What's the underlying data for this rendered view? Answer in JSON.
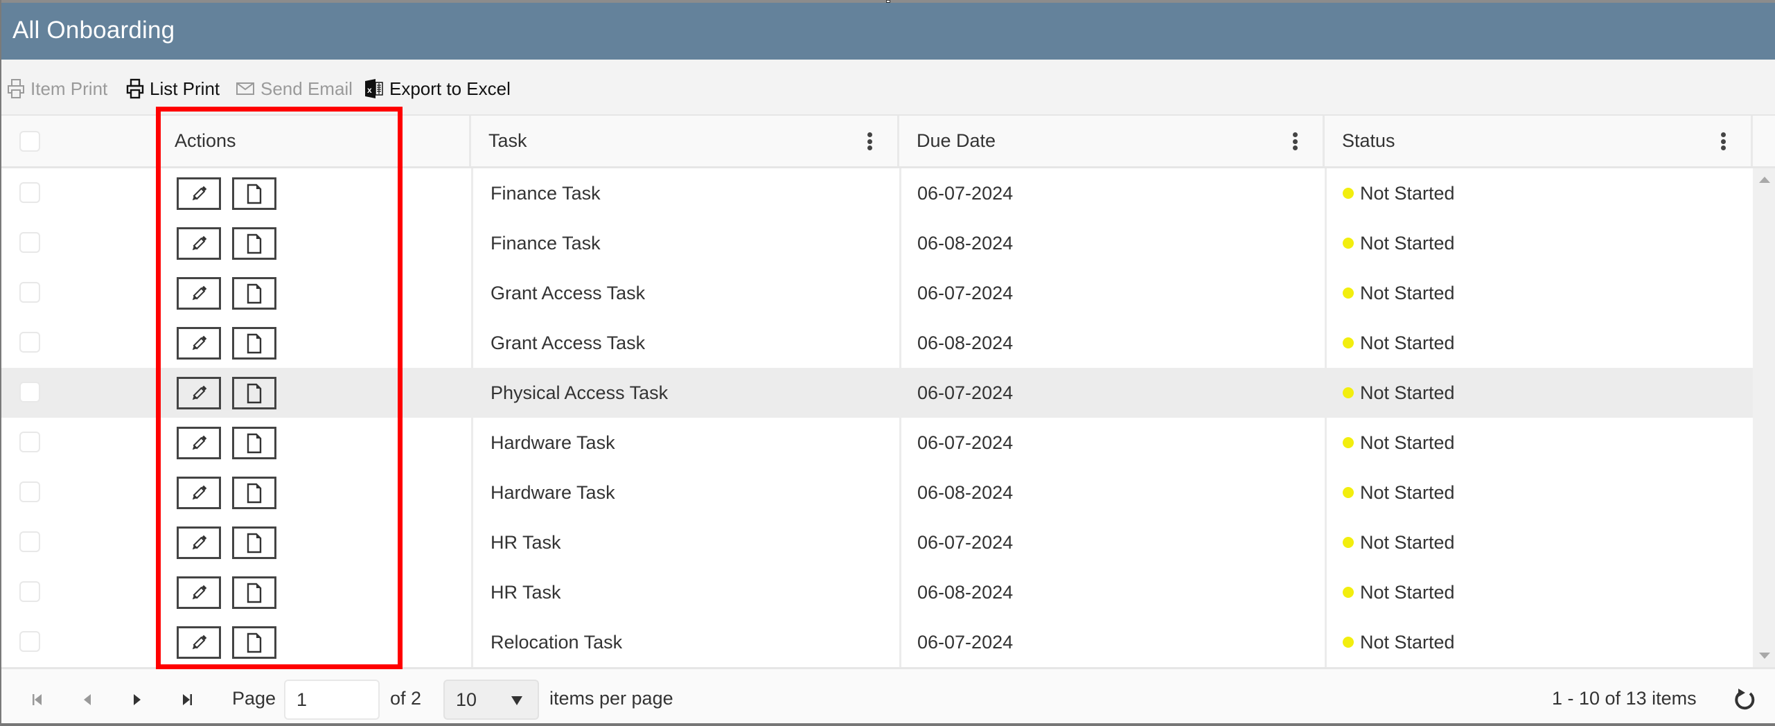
{
  "window": {
    "title": "All Onboarding",
    "title_bar_color": "#64829b"
  },
  "toolbar": {
    "items": [
      {
        "label": "Item Print",
        "icon": "printer-icon",
        "enabled": false
      },
      {
        "label": "List Print",
        "icon": "printer-icon",
        "enabled": true
      },
      {
        "label": "Send Email",
        "icon": "envelope-icon",
        "enabled": false
      },
      {
        "label": "Export to Excel",
        "icon": "excel-icon",
        "enabled": true
      }
    ]
  },
  "grid": {
    "columns": [
      {
        "key": "select",
        "label": ""
      },
      {
        "key": "actions",
        "label": "Actions"
      },
      {
        "key": "task",
        "label": "Task",
        "menu_icon": "kebab-menu-icon"
      },
      {
        "key": "due_date",
        "label": "Due Date",
        "menu_icon": "kebab-menu-icon"
      },
      {
        "key": "status",
        "label": "Status",
        "menu_icon": "kebab-menu-icon"
      }
    ],
    "action_buttons": [
      {
        "name": "edit",
        "icon": "pencil-icon"
      },
      {
        "name": "view",
        "icon": "document-icon"
      }
    ],
    "hovered_row_index": 4,
    "rows": [
      {
        "task": "Finance Task",
        "due_date": "06-07-2024",
        "status": "Not Started",
        "status_color": "#f2ee0e"
      },
      {
        "task": "Finance Task",
        "due_date": "06-08-2024",
        "status": "Not Started",
        "status_color": "#f2ee0e"
      },
      {
        "task": "Grant Access Task",
        "due_date": "06-07-2024",
        "status": "Not Started",
        "status_color": "#f2ee0e"
      },
      {
        "task": "Grant Access Task",
        "due_date": "06-08-2024",
        "status": "Not Started",
        "status_color": "#f2ee0e"
      },
      {
        "task": "Physical Access Task",
        "due_date": "06-07-2024",
        "status": "Not Started",
        "status_color": "#f2ee0e"
      },
      {
        "task": "Hardware Task",
        "due_date": "06-07-2024",
        "status": "Not Started",
        "status_color": "#f2ee0e"
      },
      {
        "task": "Hardware Task",
        "due_date": "06-08-2024",
        "status": "Not Started",
        "status_color": "#f2ee0e"
      },
      {
        "task": "HR Task",
        "due_date": "06-07-2024",
        "status": "Not Started",
        "status_color": "#f2ee0e"
      },
      {
        "task": "HR Task",
        "due_date": "06-08-2024",
        "status": "Not Started",
        "status_color": "#f2ee0e"
      },
      {
        "task": "Relocation Task",
        "due_date": "06-07-2024",
        "status": "Not Started",
        "status_color": "#f2ee0e"
      }
    ]
  },
  "pager": {
    "page_label": "Page",
    "current_page": "1",
    "of_label": "of 2",
    "page_size": "10",
    "page_size_label": "items per page",
    "summary": "1 - 10 of 13 items"
  },
  "annotation": {
    "highlight_color": "#ff0000",
    "highlighted_column": "Actions"
  }
}
